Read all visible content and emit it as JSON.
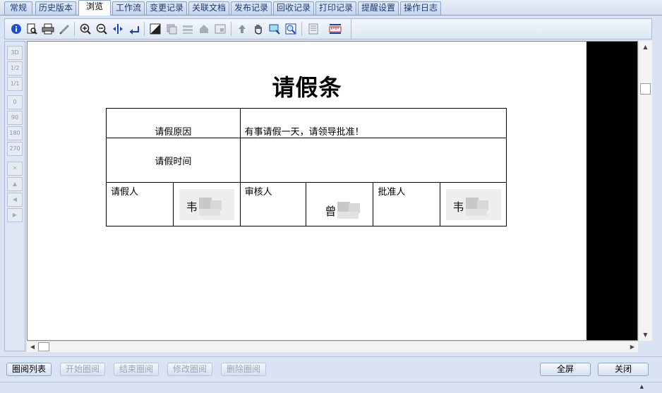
{
  "tabs": [
    {
      "label": "常规"
    },
    {
      "label": "历史版本"
    },
    {
      "label": "浏览"
    },
    {
      "label": "工作流"
    },
    {
      "label": "变更记录"
    },
    {
      "label": "关联文档"
    },
    {
      "label": "发布记录"
    },
    {
      "label": "回收记录"
    },
    {
      "label": "打印记录"
    },
    {
      "label": "提醒设置"
    },
    {
      "label": "操作日志"
    }
  ],
  "active_tab": "浏览",
  "toolbar_icons": [
    "info-icon",
    "print-preview-icon",
    "print-icon",
    "annotate-pen-icon",
    "zoom-in-icon",
    "zoom-out-icon",
    "fit-width-icon",
    "fit-page-icon",
    "invert-icon",
    "layer-icon",
    "stack-icon",
    "fill-icon",
    "frame-icon",
    "arrow-up-icon",
    "hand-pan-icon",
    "magnifier-icon",
    "zoom-region-icon",
    "page-icon",
    "ruler-icon"
  ],
  "side_tools": {
    "items": [
      {
        "label": "3D"
      },
      {
        "label": "1/2"
      },
      {
        "label": "1/1"
      },
      {
        "label": "0"
      },
      {
        "label": "90"
      },
      {
        "label": "180"
      },
      {
        "label": "270"
      },
      {
        "label": "✕"
      },
      {
        "label": "▲"
      },
      {
        "label": "◀"
      },
      {
        "label": "▶"
      }
    ]
  },
  "document": {
    "title": "请假条",
    "reason_label": "请假原因",
    "reason_value": "有事请假一天，请领导批准！",
    "time_label": "请假时间",
    "time_value": "",
    "applicant_label": "请假人",
    "reviewer_label": "审核人",
    "approver_label": "批准人",
    "applicant_sig": "韦",
    "reviewer_sig": "曾",
    "approver_sig": "韦"
  },
  "buttons": {
    "review_list": "圈阅列表",
    "start_review": "开始圈阅",
    "end_review": "结束圈阅",
    "edit_review": "修改圈阅",
    "delete_review": "删除圈阅",
    "fullscreen": "全屏",
    "close": "关闭"
  },
  "colors": {
    "background": "#d9e3f3",
    "tab_text": "#1f3b73",
    "disabled_text": "#9aa4b4",
    "viewer_side": "#000000"
  }
}
